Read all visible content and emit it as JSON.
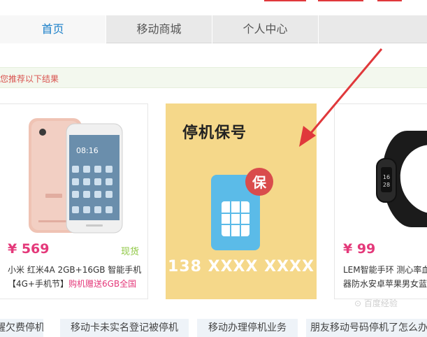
{
  "nav": {
    "tabs": [
      {
        "label": "首页",
        "active": true
      },
      {
        "label": "移动商城",
        "active": false
      },
      {
        "label": "个人中心",
        "active": false
      }
    ]
  },
  "notice": {
    "text": "您推荐以下结果"
  },
  "products": [
    {
      "image": "phone-image",
      "price": "¥ 569",
      "stock": "现货",
      "title": "小米 红米4A 2GB+16GB 智能手机",
      "subtitle_prefix": "【4G+手机节】",
      "subtitle_highlight": "购机赠送6GB全国"
    },
    {
      "image": "fitness-band-image",
      "price": "¥ 99",
      "title": "LEM智能手环 测心率血",
      "subtitle": "器防水安卓苹果男女蓝"
    }
  ],
  "promo": {
    "title": "停机保号",
    "badge": "保",
    "number": "138 XXXX XXXX"
  },
  "tags": [
    "提醒欠费停机",
    "移动卡未实名登记被停机",
    "移动办理停机业务",
    "朋友移动号码停机了怎么办"
  ],
  "colors": {
    "accent": "#1a7fc9",
    "price": "#e4397a",
    "stock": "#8cc63f",
    "promo_bg": "#f5d88a",
    "arrow": "#e0383b"
  }
}
